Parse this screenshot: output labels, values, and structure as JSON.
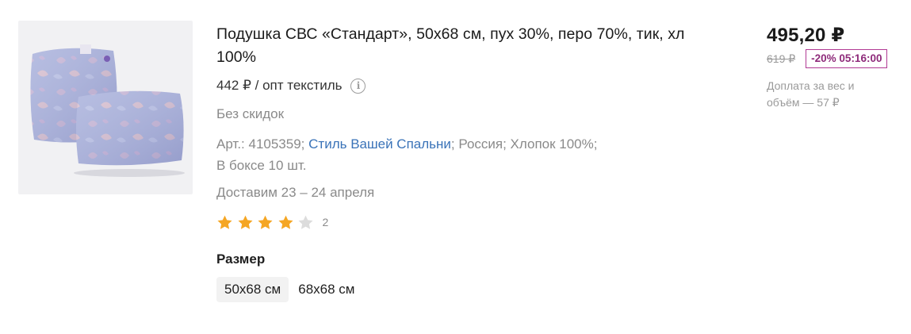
{
  "product": {
    "title": "Подушка СВС «Стандарт», 50x68 см, пух 30%, перо 70%, тик, хл 100%",
    "wholesale_price": "442 ₽ / опт текстиль",
    "discount_note": "Без скидок",
    "props": {
      "article_prefix": "Арт.: 4105359;",
      "brand": "Стиль Вашей Спальни",
      "rest_line1": "; Россия; Хлопок 100%;",
      "line2": "В боксе 10 шт."
    },
    "delivery": "Доставим 23 – 24 апреля",
    "rating": {
      "stars": 4,
      "max": 5,
      "count": "2"
    },
    "size": {
      "label": "Размер",
      "options": [
        "50x68 см",
        "68x68 см"
      ],
      "selected": "50x68 см"
    }
  },
  "pricing": {
    "price": "495,20 ₽",
    "old_price": "619 ₽",
    "discount_badge": "-20% 05:16:00",
    "surcharge": "Доплата за вес и объём — 57 ₽"
  },
  "colors": {
    "star_filled": "#f5a623",
    "star_empty": "#dcdcdc",
    "link": "#3a73b8",
    "badge": "#b13a94"
  },
  "icons": [
    "info-icon",
    "star-icon"
  ]
}
